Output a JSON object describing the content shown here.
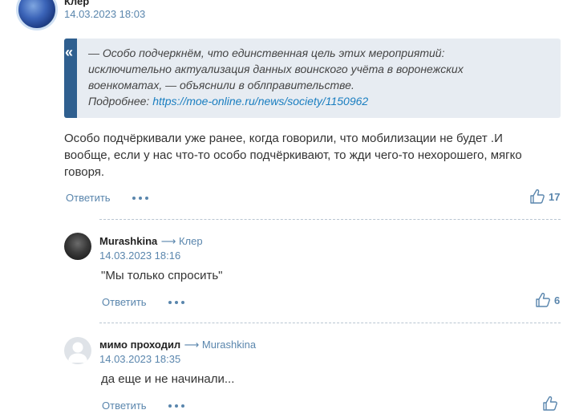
{
  "comment1": {
    "author": "Клер",
    "date": "14.03.2023 18:03",
    "quote": {
      "line1": "— Особо подчеркнём, что единственная цель этих мероприятий:",
      "line2": "исключительно актуализация данных воинского учёта в воронежских",
      "line3": "военкоматах, — объяснили в облправительстве.",
      "more_label": "Подробнее:",
      "link": "https://moe-online.ru/news/society/1150962"
    },
    "text_line1": "Особо подчёркивали уже ранее, когда говорили, что мобилизации не будет .И",
    "text_line2": "вообще, если у нас что-то особо подчёркивают, то жди чего-то нехорошего, мягко",
    "text_line3": "говоря.",
    "reply_label": "Ответить",
    "likes": "17"
  },
  "comment2": {
    "author": "Murashkina",
    "reply_to": "⟶ Клер",
    "date": "14.03.2023 18:16",
    "text": "\"Мы только спросить\"",
    "reply_label": "Ответить",
    "likes": "6"
  },
  "comment3": {
    "author": "мимо проходил",
    "reply_to": "⟶ Murashkina",
    "date": "14.03.2023 18:35",
    "text": "да еще и не начинали...",
    "reply_label": "Ответить"
  },
  "colors": {
    "accent": "#5a86ad",
    "link": "#1a7ec0",
    "quote_bg": "#e7ecf2",
    "quote_bar": "#2f5f8f"
  },
  "icons": [
    "quote-icon",
    "more-dots-icon",
    "thumbs-up-icon",
    "user-avatar-placeholder-icon"
  ]
}
